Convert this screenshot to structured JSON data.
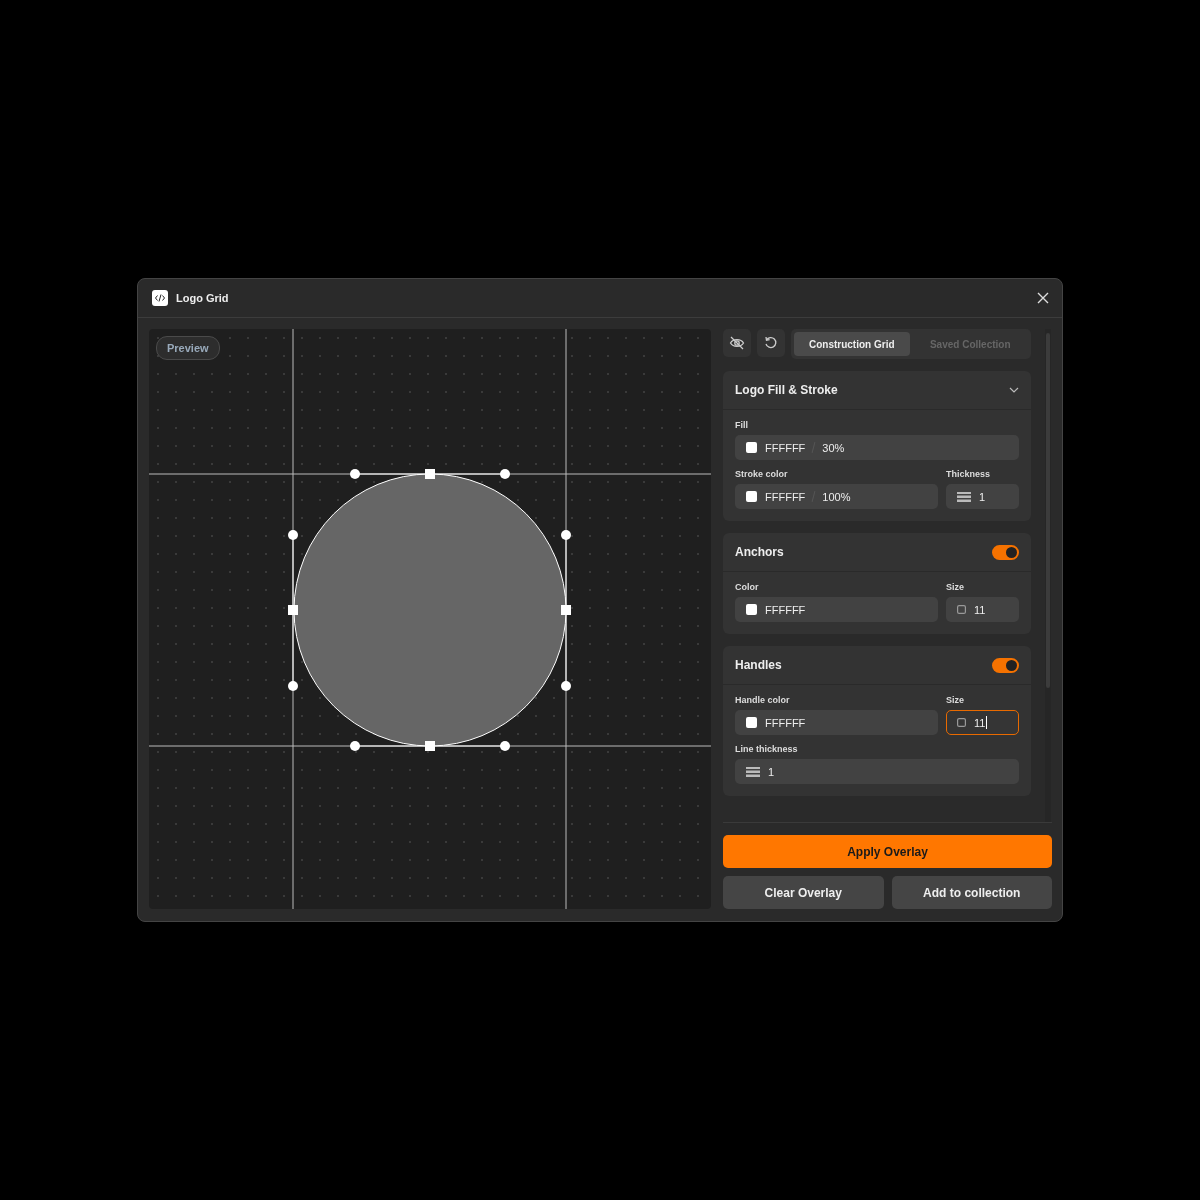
{
  "window": {
    "title": "Logo Grid"
  },
  "preview": {
    "badge": "Preview"
  },
  "toolbar": {
    "tabs": [
      {
        "label": "Construction Grid",
        "selected": true
      },
      {
        "label": "Saved Collection",
        "selected": false
      }
    ]
  },
  "sections": [
    {
      "title": "Logo Fill & Stroke",
      "kind": "collapsible",
      "expanded": true,
      "rows": [
        [
          {
            "label": "Fill",
            "kind": "color",
            "value": "FFFFFF",
            "suffix": "30%",
            "focused": false
          }
        ],
        [
          {
            "label": "Stroke color",
            "kind": "color",
            "value": "FFFFFF",
            "suffix": "100%",
            "focused": false
          },
          {
            "label": "Thickness",
            "kind": "weight",
            "value": "1",
            "focused": false
          }
        ]
      ]
    },
    {
      "title": "Anchors",
      "kind": "toggle",
      "on": true,
      "rows": [
        [
          {
            "label": "Color",
            "kind": "color",
            "value": "FFFFFF",
            "focused": false
          },
          {
            "label": "Size",
            "kind": "size",
            "value": "11",
            "focused": false
          }
        ]
      ]
    },
    {
      "title": "Handles",
      "kind": "toggle",
      "on": true,
      "rows": [
        [
          {
            "label": "Handle color",
            "kind": "color",
            "value": "FFFFFF",
            "focused": false
          },
          {
            "label": "Size",
            "kind": "size",
            "value": "11",
            "focused": true
          }
        ],
        [
          {
            "label": "Line thickness",
            "kind": "weight",
            "value": "1",
            "focused": false
          }
        ]
      ]
    }
  ],
  "buttons": [
    {
      "label": "Apply Overlay",
      "kind": "primary"
    },
    {
      "label": "Clear Overlay",
      "kind": "secondary"
    },
    {
      "label": "Add to collection",
      "kind": "secondary"
    }
  ]
}
